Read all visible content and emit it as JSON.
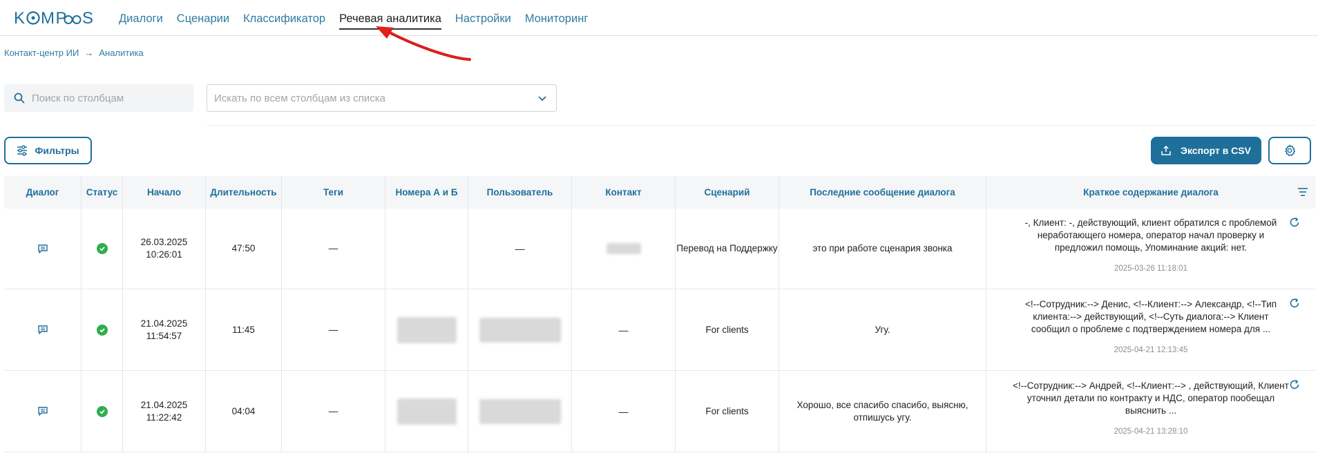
{
  "app": {
    "logo_text": "KOMPaS"
  },
  "nav": {
    "items": [
      "Диалоги",
      "Сценарии",
      "Классификатор",
      "Речевая аналитика",
      "Настройки",
      "Мониторинг"
    ],
    "active": "Речевая аналитика"
  },
  "breadcrumb": {
    "root": "Контакт-центр ИИ",
    "current": "Аналитика"
  },
  "search": {
    "placeholder": "Поиск по столбцам"
  },
  "column_select": {
    "placeholder": "Искать по всем столбцам из списка"
  },
  "toolbar": {
    "filters_label": "Фильтры",
    "export_label": "Экспорт в CSV"
  },
  "table": {
    "headers": [
      "Диалог",
      "Статус",
      "Начало",
      "Длительность",
      "Теги",
      "Номера А и Б",
      "Пользователь",
      "Контакт",
      "Сценарий",
      "Последние сообщение диалога",
      "Краткое содержание диалога"
    ],
    "rows": [
      {
        "start_date": "26.03.2025",
        "start_time": "10:26:01",
        "duration": "47:50",
        "tags": "—",
        "numbers": "",
        "user": "—",
        "contact": "",
        "scenario": "Перевод на Поддержку",
        "last_message": "это при работе сценария звонка",
        "summary": "-, Клиент: -, действующий, клиент обратился с проблемой неработающего номера, оператор начал проверку и предложил помощь, Упоминание акций: нет.",
        "summary_time": "2025-03-26 11:18:01"
      },
      {
        "start_date": "21.04.2025",
        "start_time": "11:54:57",
        "duration": "11:45",
        "tags": "—",
        "numbers": "",
        "user": "",
        "contact": "—",
        "scenario": "For clients",
        "last_message": "Угу.",
        "summary": "<!--Сотрудник:--> Денис, <!--Клиент:--> Александр, <!--Тип клиента:--> действующий, <!--Суть диалога:--> Клиент сообщил о проблеме с подтверждением номера для ...",
        "summary_time": "2025-04-21 12:13:45"
      },
      {
        "start_date": "21.04.2025",
        "start_time": "11:22:42",
        "duration": "04:04",
        "tags": "—",
        "numbers": "",
        "user": "",
        "contact": "—",
        "scenario": "For clients",
        "last_message": "Хорошо, все спасибо спасибо, выясню, отпишусь угу.",
        "summary": "<!--Сотрудник:--> Андрей, <!--Клиент:--> , действующий, Клиент уточнил детали по контракту и НДС, оператор пообещал выяснить ...",
        "summary_time": "2025-04-21 13:28:10"
      }
    ]
  },
  "colors": {
    "brand": "#1e6f9a",
    "status_ok": "#2fae4e",
    "annotation_arrow": "#e0201b"
  },
  "icons": {
    "search": "search-icon",
    "filter": "sliders-icon",
    "export": "upload-icon",
    "settings": "gear-icon",
    "dialog": "chat-icon",
    "status": "check-circle-icon",
    "refresh": "refresh-icon",
    "columns_menu": "menu-lines-icon"
  }
}
